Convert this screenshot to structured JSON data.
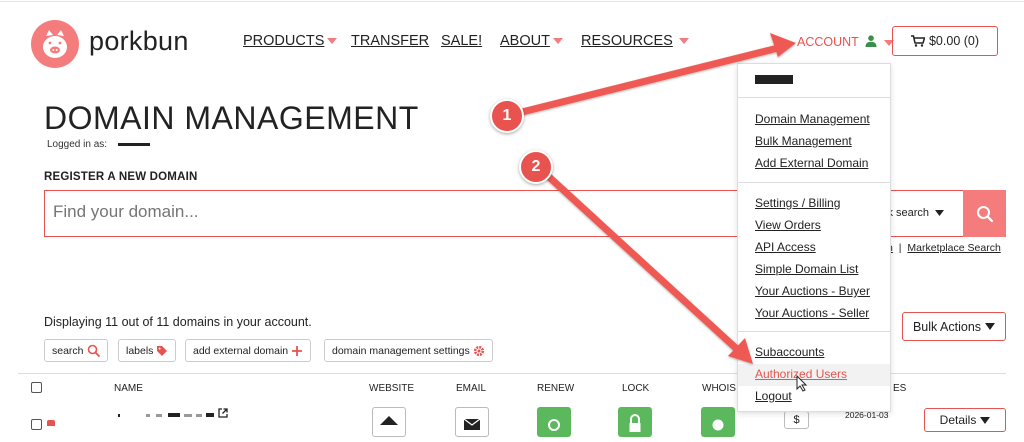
{
  "brand": {
    "name": "porkbun",
    "color": "#f47c7c"
  },
  "nav": {
    "items": [
      {
        "label": "PRODUCTS",
        "caret": true
      },
      {
        "label": "TRANSFER",
        "caret": false
      },
      {
        "label": "SALE!",
        "caret": false
      },
      {
        "label": "ABOUT",
        "caret": true
      },
      {
        "label": "RESOURCES",
        "caret": true
      }
    ],
    "account_label": "ACCOUNT",
    "cart_label": "$0.00 (0)"
  },
  "page": {
    "title": "DOMAIN MANAGEMENT",
    "logged_in_label": "Logged in as:",
    "register_label": "REGISTER A NEW DOMAIN",
    "search_placeholder": "Find your domain...",
    "bulk_search_label": "lk search",
    "sub_link_1": "h",
    "sub_link_separator": "|",
    "sub_link_2": "Marketplace Search"
  },
  "domains": {
    "display_text": "Displaying 11 out of 11 domains in your account.",
    "tools": [
      {
        "label": "search",
        "icon": "search-icon"
      },
      {
        "label": "labels",
        "icon": "tag-icon"
      },
      {
        "label": "add external domain",
        "icon": "plus-icon"
      },
      {
        "label": "domain management settings",
        "icon": "gear-icon"
      }
    ],
    "bulk_actions_label": "Bulk Actions",
    "columns": [
      "NAME",
      "WEBSITE",
      "EMAIL",
      "RENEW",
      "LOCK",
      "WHOIS",
      "ES"
    ],
    "row": {
      "date": "2026-01-03",
      "details_label": "Details"
    }
  },
  "account_menu": {
    "group1": [
      "Domain Management",
      "Bulk Management",
      "Add External Domain"
    ],
    "group2": [
      "Settings / Billing",
      "View Orders",
      "API Access",
      "Simple Domain List",
      "Your Auctions - Buyer",
      "Your Auctions - Seller"
    ],
    "group3": [
      "Subaccounts",
      "Authorized Users",
      "Logout"
    ],
    "highlighted": "Authorized Users"
  },
  "annotations": [
    {
      "number": "1"
    },
    {
      "number": "2"
    }
  ],
  "colors": {
    "accent": "#e8534f",
    "annotation": "#e8534f",
    "green": "#5cb85c"
  }
}
